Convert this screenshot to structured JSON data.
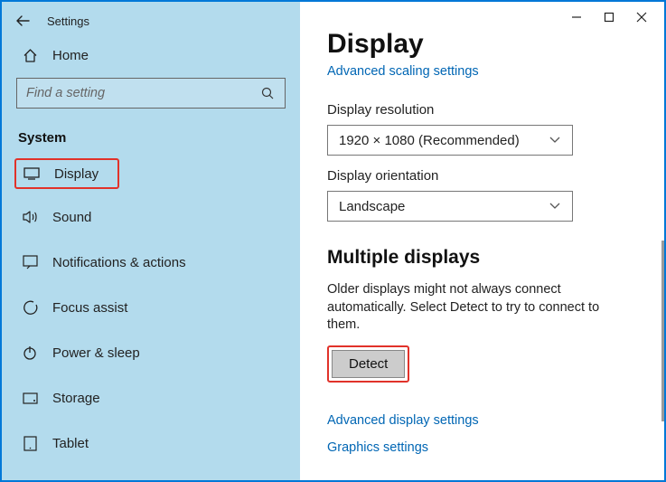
{
  "header": {
    "title": "Settings"
  },
  "sidebar": {
    "home_label": "Home",
    "search_placeholder": "Find a setting",
    "section": "System",
    "items": [
      {
        "label": "Display"
      },
      {
        "label": "Sound"
      },
      {
        "label": "Notifications & actions"
      },
      {
        "label": "Focus assist"
      },
      {
        "label": "Power & sleep"
      },
      {
        "label": "Storage"
      },
      {
        "label": "Tablet"
      }
    ]
  },
  "main": {
    "title": "Display",
    "advanced_scaling_link": "Advanced scaling settings",
    "resolution_label": "Display resolution",
    "resolution_value": "1920 × 1080 (Recommended)",
    "orientation_label": "Display orientation",
    "orientation_value": "Landscape",
    "multi_title": "Multiple displays",
    "multi_desc": "Older displays might not always connect automatically. Select Detect to try to connect to them.",
    "detect_button": "Detect",
    "advanced_display_link": "Advanced display settings",
    "graphics_link": "Graphics settings"
  }
}
